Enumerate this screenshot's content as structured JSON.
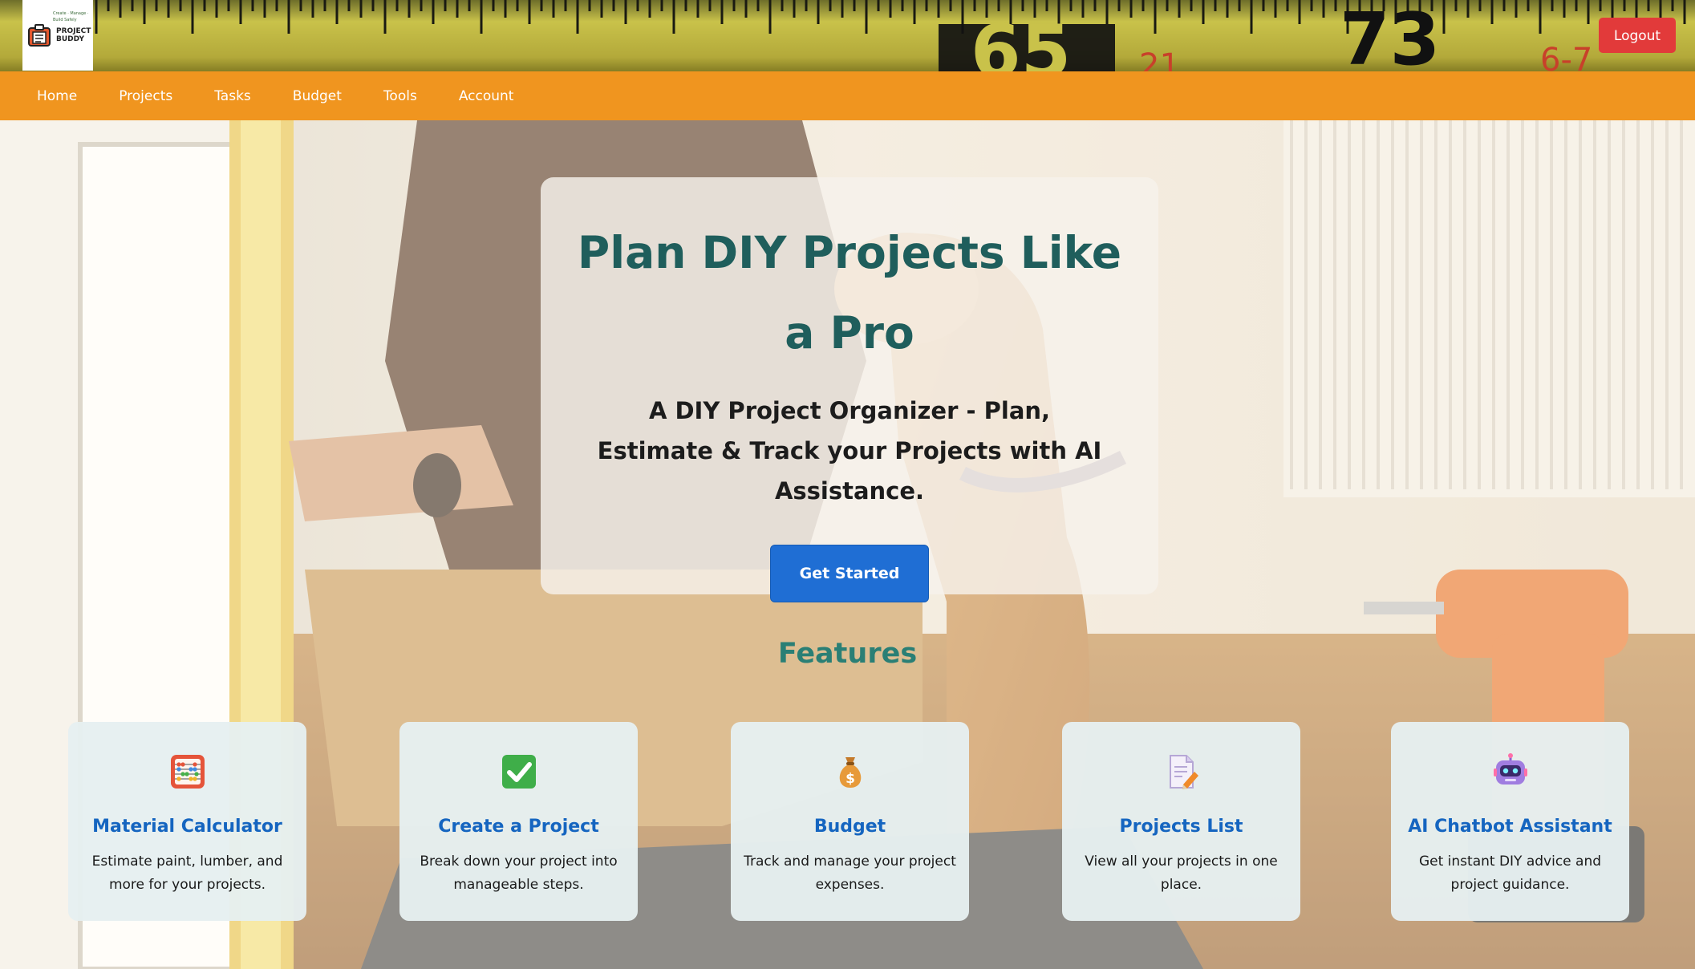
{
  "brand": {
    "logo_tagline": "Create · Manage · Build Safely",
    "logo_name_line1": "PROJECT",
    "logo_name_line2": "BUDDY"
  },
  "header": {
    "logout_label": "Logout"
  },
  "nav": {
    "items": [
      {
        "label": "Home"
      },
      {
        "label": "Projects"
      },
      {
        "label": "Tasks"
      },
      {
        "label": "Budget"
      },
      {
        "label": "Tools"
      },
      {
        "label": "Account"
      }
    ]
  },
  "hero": {
    "title": "Plan DIY Projects Like a Pro",
    "subtitle": "A DIY Project Organizer - Plan, Estimate & Track your Projects with AI Assistance.",
    "cta_label": "Get Started"
  },
  "features": {
    "heading": "Features",
    "cards": [
      {
        "icon": "abacus-icon",
        "title": "Material Calculator",
        "description": "Estimate paint, lumber, and more for your projects."
      },
      {
        "icon": "checkmark-icon",
        "title": "Create a Project",
        "description": "Break down your project into manageable steps."
      },
      {
        "icon": "money-bag-icon",
        "title": "Budget",
        "description": "Track and manage your project expenses."
      },
      {
        "icon": "document-pencil-icon",
        "title": "Projects List",
        "description": "View all your projects in one place."
      },
      {
        "icon": "robot-icon",
        "title": "AI Chatbot Assistant",
        "description": "Get instant DIY advice and project guidance."
      }
    ]
  },
  "colors": {
    "nav_bg": "#f0951f",
    "logout_bg": "#e23a3a",
    "cta_bg": "#1f6ed4",
    "hero_title": "#1f5e5c",
    "features_heading": "#2a7f75",
    "feature_title": "#1565c0"
  }
}
